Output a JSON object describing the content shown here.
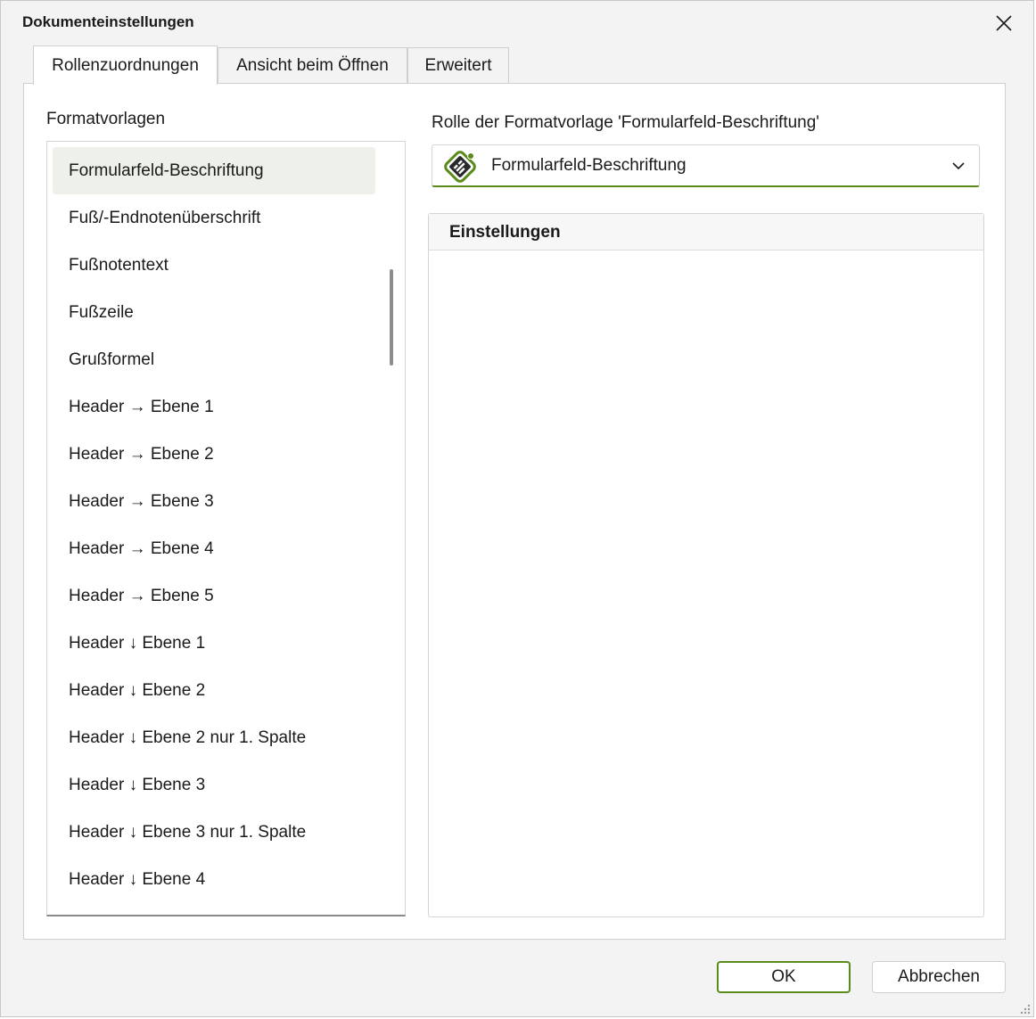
{
  "window": {
    "title": "Dokumenteinstellungen"
  },
  "tabs": [
    {
      "label": "Rollenzuordnungen",
      "active": true
    },
    {
      "label": "Ansicht beim Öffnen",
      "active": false
    },
    {
      "label": "Erweitert",
      "active": false
    }
  ],
  "styles_panel": {
    "label": "Formatvorlagen",
    "items": [
      "Formularfeld-Beschriftung",
      "Fuß/-Endnotenüberschrift",
      "Fußnotentext",
      "Fußzeile",
      "Grußformel",
      "Header → Ebene 1",
      "Header → Ebene 2",
      "Header → Ebene 3",
      "Header → Ebene 4",
      "Header → Ebene 5",
      "Header ↓ Ebene 1",
      "Header ↓ Ebene 2",
      "Header ↓ Ebene 2 nur 1. Spalte",
      "Header ↓ Ebene 3",
      "Header ↓ Ebene 3 nur 1. Spalte",
      "Header ↓ Ebene 4"
    ],
    "selected_item": "Formularfeld-Beschriftung"
  },
  "role_panel": {
    "label": "Rolle der Formatvorlage 'Formularfeld-Beschriftung'",
    "dropdown": {
      "value": "Formularfeld-Beschriftung",
      "icon": "form-field-label-icon"
    }
  },
  "settings_panel": {
    "title": "Einstellungen"
  },
  "buttons": {
    "ok": "OK",
    "cancel": "Abbrechen"
  },
  "colors": {
    "accent": "#5a8a1a",
    "selection_bg": "#eef1e9",
    "window_bg": "#f3f3f3"
  }
}
